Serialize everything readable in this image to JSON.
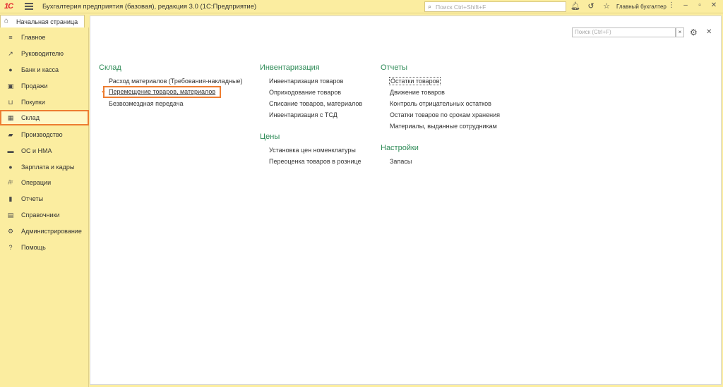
{
  "window": {
    "logo": "1С",
    "title": "Бухгалтерия предприятия (базовая), редакция 3.0  (1С:Предприятие)",
    "search_placeholder": "Поиск Ctrl+Shift+F",
    "user": "Главный бухгалтер"
  },
  "tabs": {
    "home": "Начальная страница"
  },
  "sidebar": {
    "items": [
      {
        "label": "Главное",
        "icon": "≡"
      },
      {
        "label": "Руководителю",
        "icon": "↗"
      },
      {
        "label": "Банк и касса",
        "icon": "●"
      },
      {
        "label": "Продажи",
        "icon": "▣"
      },
      {
        "label": "Покупки",
        "icon": "⊔"
      },
      {
        "label": "Склад",
        "icon": "▦"
      },
      {
        "label": "Производство",
        "icon": "▰"
      },
      {
        "label": "ОС и НМА",
        "icon": "▬"
      },
      {
        "label": "Зарплата и кадры",
        "icon": "●"
      },
      {
        "label": "Операции",
        "icon": "Дт"
      },
      {
        "label": "Отчеты",
        "icon": "▮"
      },
      {
        "label": "Справочники",
        "icon": "▤"
      },
      {
        "label": "Администрирование",
        "icon": "⚙"
      },
      {
        "label": "Помощь",
        "icon": "?"
      }
    ],
    "active": "Склад"
  },
  "main": {
    "search_placeholder": "Поиск (Ctrl+F)",
    "clear": "×",
    "sections": {
      "sklad": {
        "title": "Склад",
        "links": [
          "Расход материалов (Требования-накладные)",
          "Перемещение товаров, материалов",
          "Безвозмездная передача"
        ]
      },
      "inventarizaciya": {
        "title": "Инвентаризация",
        "links": [
          "Инвентаризация товаров",
          "Оприходование товаров",
          "Списание товаров, материалов",
          "Инвентаризация с ТСД"
        ]
      },
      "ceny": {
        "title": "Цены",
        "links": [
          "Установка цен номенклатуры",
          "Переоценка товаров в рознице"
        ]
      },
      "otchety": {
        "title": "Отчеты",
        "links": [
          "Остатки товаров",
          "Движение товаров",
          "Контроль отрицательных остатков",
          "Остатки товаров по срокам хранения",
          "Материалы, выданные сотрудникам"
        ]
      },
      "nastroiki": {
        "title": "Настройки",
        "links": [
          "Запасы"
        ]
      }
    }
  },
  "colors": {
    "accent": "#ed7d31",
    "section": "#2e8b57",
    "panel": "#fbeda0"
  }
}
